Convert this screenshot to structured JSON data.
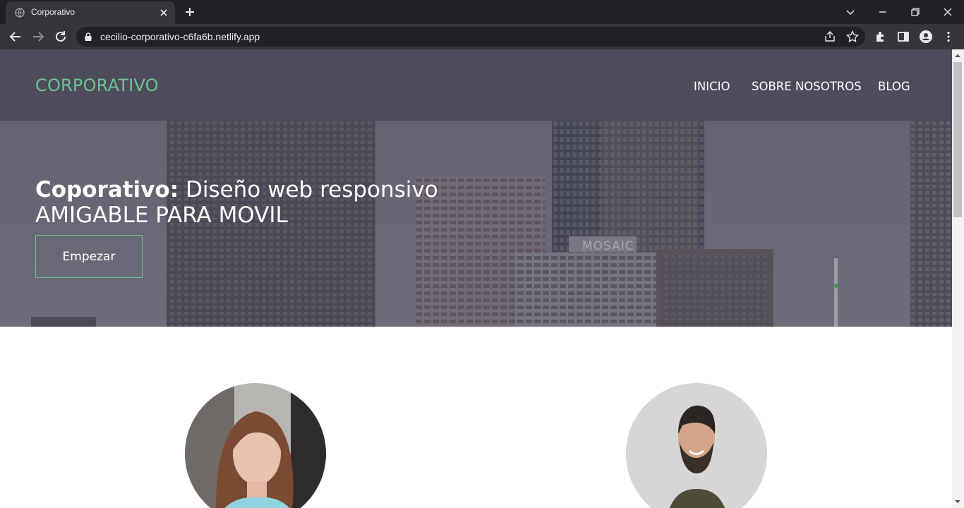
{
  "browser": {
    "tab_title": "Corporativo",
    "url": "cecilio-corporativo-c6fa6b.netlify.app"
  },
  "site": {
    "logo": "CORPORATIVO",
    "nav": [
      {
        "label": "INICIO"
      },
      {
        "label": "SOBRE NOSOTROS"
      },
      {
        "label": "BLOG"
      }
    ]
  },
  "hero": {
    "title_bold": "Coporativo:",
    "title_rest": " Diseño web responsivo",
    "subtitle": "AMIGABLE PARA MOVIL",
    "button": "Empezar",
    "building_sign": "MOSAIC"
  },
  "colors": {
    "accent": "#6cc391",
    "header_bg": "#4e4b5c",
    "chrome_dark": "#202124",
    "chrome_mid": "#35363a"
  }
}
